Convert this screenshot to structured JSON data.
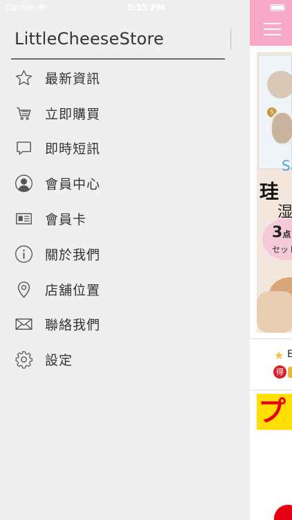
{
  "status": {
    "carrier": "Carrier",
    "time": "5:55 PM"
  },
  "drawer": {
    "title": "LittleCheeseStore",
    "items": [
      {
        "label": "最新資訊",
        "icon": "star-icon"
      },
      {
        "label": "立即購買",
        "icon": "cart-icon"
      },
      {
        "label": "即時短訊",
        "icon": "chat-bubble-icon"
      },
      {
        "label": "會員中心",
        "icon": "user-avatar-icon"
      },
      {
        "label": "會員卡",
        "icon": "member-card-icon"
      },
      {
        "label": "關於我們",
        "icon": "info-icon"
      },
      {
        "label": "店舖位置",
        "icon": "location-pin-icon"
      },
      {
        "label": "聯絡我們",
        "icon": "envelope-icon"
      },
      {
        "label": "設定",
        "icon": "gear-icon"
      }
    ]
  },
  "content": {
    "banner": {
      "brand": "Sa",
      "headline": "珪",
      "sub": "湿",
      "badge_num": "3",
      "badge_unit": "点",
      "badge_text": "セット",
      "box_number": "5"
    },
    "promo": {
      "text": "E",
      "badge": "得"
    },
    "product": {
      "logo": "プ"
    }
  },
  "colors": {
    "header": "#f7a9c7",
    "drawer_bg": "#efefef",
    "text": "#333333",
    "accent_red": "#e60012",
    "accent_yellow": "#ffde00"
  }
}
